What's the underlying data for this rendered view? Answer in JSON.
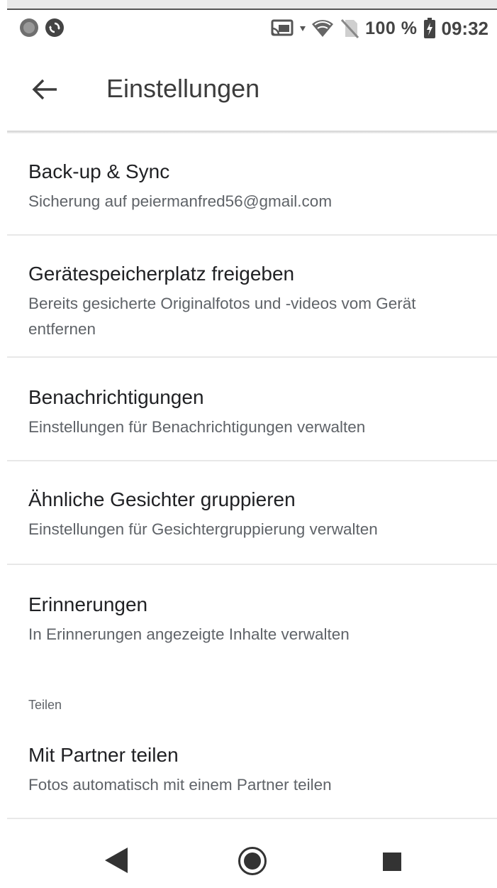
{
  "status_bar": {
    "battery": "100 %",
    "time": "09:32",
    "icons": [
      "circle-icon",
      "sync-icon",
      "cast-icon",
      "wifi-icon",
      "no-sim-icon",
      "battery-icon"
    ]
  },
  "app_bar": {
    "title": "Einstellungen"
  },
  "settings": [
    {
      "title": "Back-up & Sync",
      "subtitle": "Sicherung auf peiermanfred56@gmail.com"
    },
    {
      "title": "Gerätespeicherplatz freigeben",
      "subtitle": "Bereits gesicherte Originalfotos und -videos vom Gerät entfernen"
    },
    {
      "title": "Benachrichtigungen",
      "subtitle": "Einstellungen für Benachrichtigungen verwalten"
    },
    {
      "title": "Ähnliche Gesichter gruppieren",
      "subtitle": "Einstellungen für Gesichtergruppierung verwalten"
    },
    {
      "title": "Erinnerungen",
      "subtitle": "In Erinnerungen angezeigte Inhalte verwalten"
    }
  ],
  "section": {
    "label": "Teilen",
    "items": [
      {
        "title": "Mit Partner teilen",
        "subtitle": "Fotos automatisch mit einem Partner teilen"
      }
    ]
  },
  "nav_bar": {
    "icons": [
      "nav-back-icon",
      "nav-home-icon",
      "nav-recents-icon"
    ]
  }
}
